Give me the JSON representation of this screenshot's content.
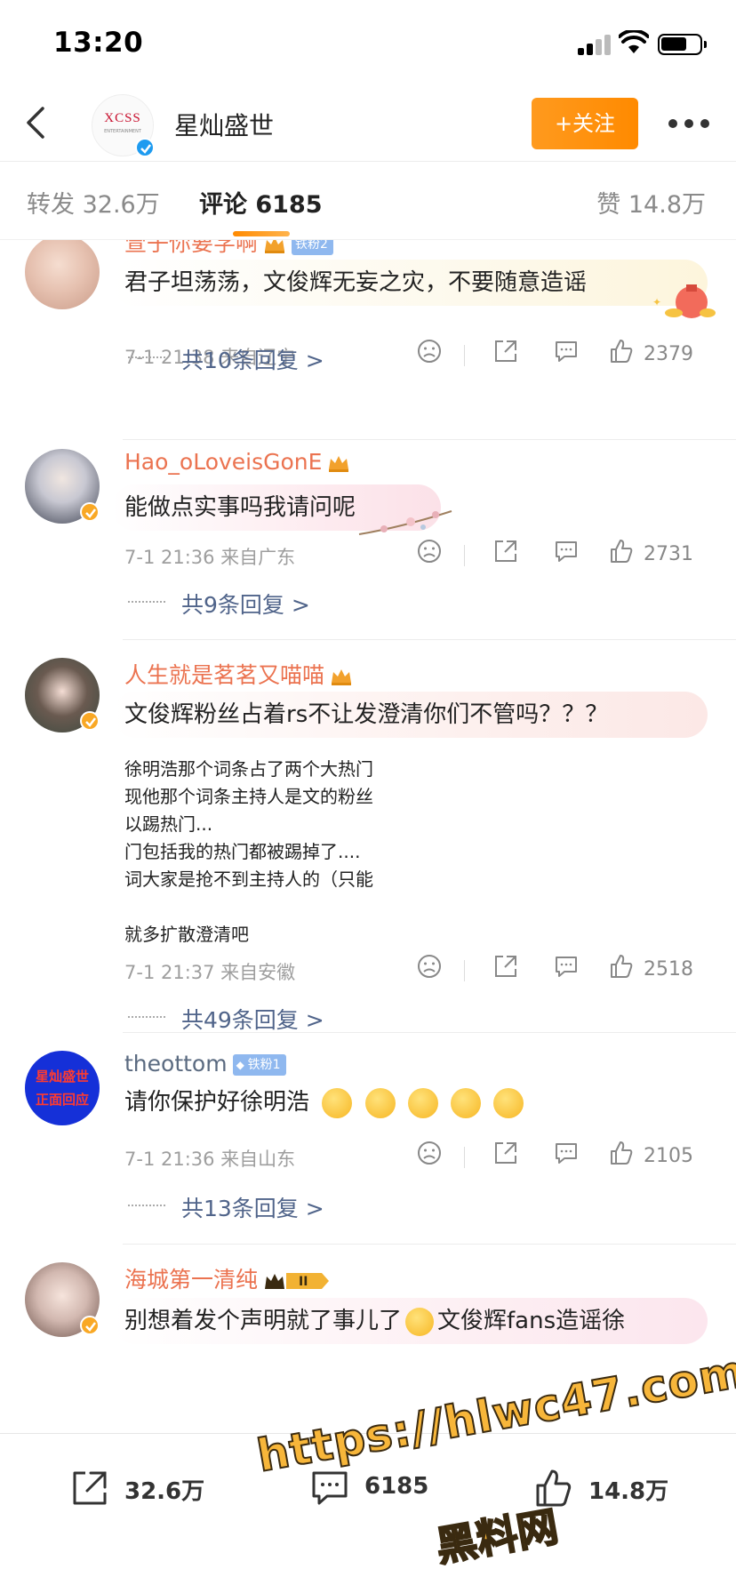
{
  "status_bar": {
    "time": "13:20"
  },
  "header": {
    "title": "星灿盛世",
    "avatar_logo": "XCSS",
    "avatar_logo_sub": "ENTERTAINMENT",
    "follow_label": "+关注"
  },
  "tabs": {
    "reposts": "转发 32.6万",
    "comments": "评论 6185",
    "likes": "赞 14.8万"
  },
  "comments": [
    {
      "username": "萱子你要学啊",
      "fan_badge": "铁粉2",
      "text": "君子坦荡荡，文俊辉无妄之灾，不要随意造谣",
      "meta": "7-1 21:38 来自辽宁",
      "likes": "2379",
      "replies": "共10条回复 >"
    },
    {
      "username": "Hao_oLoveisGonE",
      "text": "能做点实事吗我请问呢",
      "meta": "7-1 21:36 来自广东",
      "likes": "2731",
      "replies": "共9条回复 >"
    },
    {
      "username": "人生就是茗茗又喵喵",
      "text": "文俊辉粉丝占着rs不让发澄清你们不管吗？？？",
      "image_lines": "徐明浩那个词条占了两个大热门\n现他那个词条主持人是文的粉丝\n以踢热门...\n门包括我的热门都被踢掉了....\n词大家是抢不到主持人的（只能\n\n就多扩散澄清吧",
      "meta": "7-1 21:37 来自安徽",
      "likes": "2518",
      "replies": "共49条回复 >"
    },
    {
      "username": "theottom",
      "fan_badge": "铁粉1",
      "avatar_text_1": "星灿盛世",
      "avatar_text_2": "正面回应",
      "text": "请你保护好徐明浩",
      "meta": "7-1 21:36 来自山东",
      "likes": "2105",
      "replies": "共13条回复 >"
    },
    {
      "username": "海城第一清纯",
      "text_before": "别想着发个声明就了事儿了",
      "text_after": "文俊辉fans造谣徐"
    }
  ],
  "bottom_bar": {
    "reposts": "32.6万",
    "comments": "6185",
    "likes": "14.8万"
  },
  "watermark": {
    "line1": "https://hlwc47.com",
    "line2": "黑料网"
  },
  "colors": {
    "accent_orange": "#ff8a00",
    "username_orange": "#eb7350",
    "link_blue": "#50648a",
    "verify_blue": "#1e9bf0",
    "verify_gold": "#f9a825"
  }
}
